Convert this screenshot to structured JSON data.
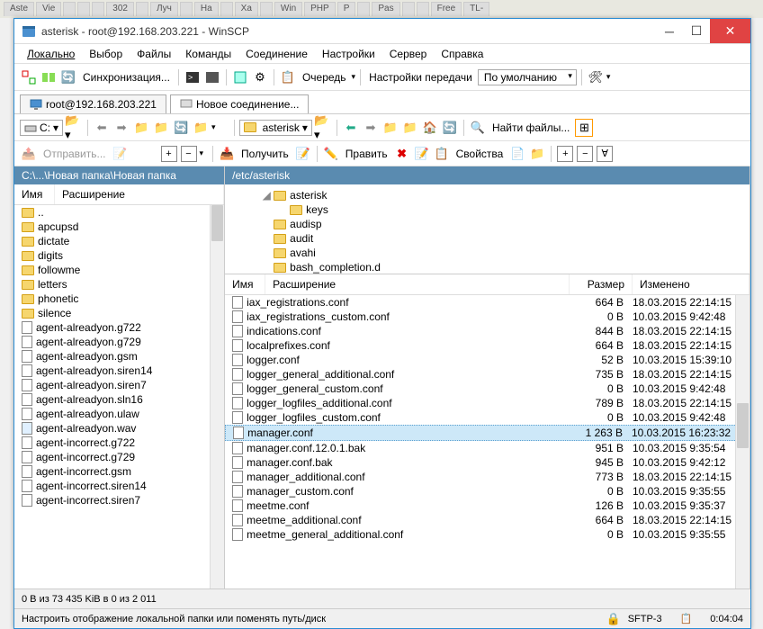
{
  "bg_tabs": [
    "Aste",
    "Vie",
    "",
    "",
    "",
    "302",
    "",
    "Луч",
    "",
    "Ha",
    "",
    "Xa",
    "",
    "Win",
    "PHP",
    "P",
    "",
    "Pas",
    "",
    "",
    "Free",
    "TL-"
  ],
  "title": "asterisk - root@192.168.203.221 - WinSCP",
  "menu": {
    "local": "Локально",
    "vyb": "Выбор",
    "files": "Файлы",
    "cmd": "Команды",
    "conn": "Соединение",
    "settings": "Настройки",
    "server": "Сервер",
    "help": "Справка"
  },
  "tb1": {
    "sync": "Синхронизация...",
    "queue": "Очередь",
    "transfer": "Настройки передачи",
    "transfer_mode": "По умолчанию"
  },
  "tabs": {
    "t1": "root@192.168.203.221",
    "t2": "Новое соединение..."
  },
  "nav": {
    "drive": "C:",
    "remote_folder": "asterisk",
    "find": "Найти файлы..."
  },
  "act": {
    "send": "Отправить...",
    "get": "Получить",
    "edit": "Править",
    "props": "Свойства"
  },
  "left": {
    "path": "C:\\...\\Новая папка\\Новая папка",
    "cols": {
      "name": "Имя",
      "ext": "Расширение"
    },
    "items": [
      {
        "n": "..",
        "t": "up"
      },
      {
        "n": "apcupsd",
        "t": "d"
      },
      {
        "n": "dictate",
        "t": "d"
      },
      {
        "n": "digits",
        "t": "d"
      },
      {
        "n": "followme",
        "t": "d"
      },
      {
        "n": "letters",
        "t": "d"
      },
      {
        "n": "phonetic",
        "t": "d"
      },
      {
        "n": "silence",
        "t": "d"
      },
      {
        "n": "agent-alreadyon.g722",
        "t": "f"
      },
      {
        "n": "agent-alreadyon.g729",
        "t": "f"
      },
      {
        "n": "agent-alreadyon.gsm",
        "t": "f"
      },
      {
        "n": "agent-alreadyon.siren14",
        "t": "f"
      },
      {
        "n": "agent-alreadyon.siren7",
        "t": "f"
      },
      {
        "n": "agent-alreadyon.sln16",
        "t": "f"
      },
      {
        "n": "agent-alreadyon.ulaw",
        "t": "f"
      },
      {
        "n": "agent-alreadyon.wav",
        "t": "a"
      },
      {
        "n": "agent-incorrect.g722",
        "t": "f"
      },
      {
        "n": "agent-incorrect.g729",
        "t": "f"
      },
      {
        "n": "agent-incorrect.gsm",
        "t": "f"
      },
      {
        "n": "agent-incorrect.siren14",
        "t": "f"
      },
      {
        "n": "agent-incorrect.siren7",
        "t": "f"
      }
    ]
  },
  "right": {
    "path": "/etc/asterisk",
    "tree": [
      {
        "n": "asterisk",
        "lvl": 3,
        "exp": true
      },
      {
        "n": "keys",
        "lvl": 4
      },
      {
        "n": "audisp",
        "lvl": 3
      },
      {
        "n": "audit",
        "lvl": 3
      },
      {
        "n": "avahi",
        "lvl": 3
      },
      {
        "n": "bash_completion.d",
        "lvl": 3
      }
    ],
    "cols": {
      "name": "Имя",
      "ext": "Расширение",
      "size": "Размер",
      "mod": "Изменено"
    },
    "items": [
      {
        "n": "iax_registrations.conf",
        "s": "664 B",
        "d": "18.03.2015 22:14:15"
      },
      {
        "n": "iax_registrations_custom.conf",
        "s": "0 B",
        "d": "10.03.2015 9:42:48"
      },
      {
        "n": "indications.conf",
        "s": "844 B",
        "d": "18.03.2015 22:14:15"
      },
      {
        "n": "localprefixes.conf",
        "s": "664 B",
        "d": "18.03.2015 22:14:15"
      },
      {
        "n": "logger.conf",
        "s": "52 B",
        "d": "10.03.2015 15:39:10"
      },
      {
        "n": "logger_general_additional.conf",
        "s": "735 B",
        "d": "18.03.2015 22:14:15"
      },
      {
        "n": "logger_general_custom.conf",
        "s": "0 B",
        "d": "10.03.2015 9:42:48"
      },
      {
        "n": "logger_logfiles_additional.conf",
        "s": "789 B",
        "d": "18.03.2015 22:14:15"
      },
      {
        "n": "logger_logfiles_custom.conf",
        "s": "0 B",
        "d": "10.03.2015 9:42:48"
      },
      {
        "n": "manager.conf",
        "s": "1 263 B",
        "d": "10.03.2015 16:23:32",
        "sel": true
      },
      {
        "n": "manager.conf.12.0.1.bak",
        "s": "951 B",
        "d": "10.03.2015 9:35:54"
      },
      {
        "n": "manager.conf.bak",
        "s": "945 B",
        "d": "10.03.2015 9:42:12"
      },
      {
        "n": "manager_additional.conf",
        "s": "773 B",
        "d": "18.03.2015 22:14:15"
      },
      {
        "n": "manager_custom.conf",
        "s": "0 B",
        "d": "10.03.2015 9:35:55"
      },
      {
        "n": "meetme.conf",
        "s": "126 B",
        "d": "10.03.2015 9:35:37"
      },
      {
        "n": "meetme_additional.conf",
        "s": "664 B",
        "d": "18.03.2015 22:14:15"
      },
      {
        "n": "meetme_general_additional.conf",
        "s": "0 B",
        "d": "10.03.2015 9:35:55"
      }
    ]
  },
  "status": "0 B из 73 435 KiB в 0 из 2 011",
  "hint": "Настроить отображение локальной папки или поменять путь/диск",
  "proto": "SFTP-3",
  "time": "0:04:04"
}
